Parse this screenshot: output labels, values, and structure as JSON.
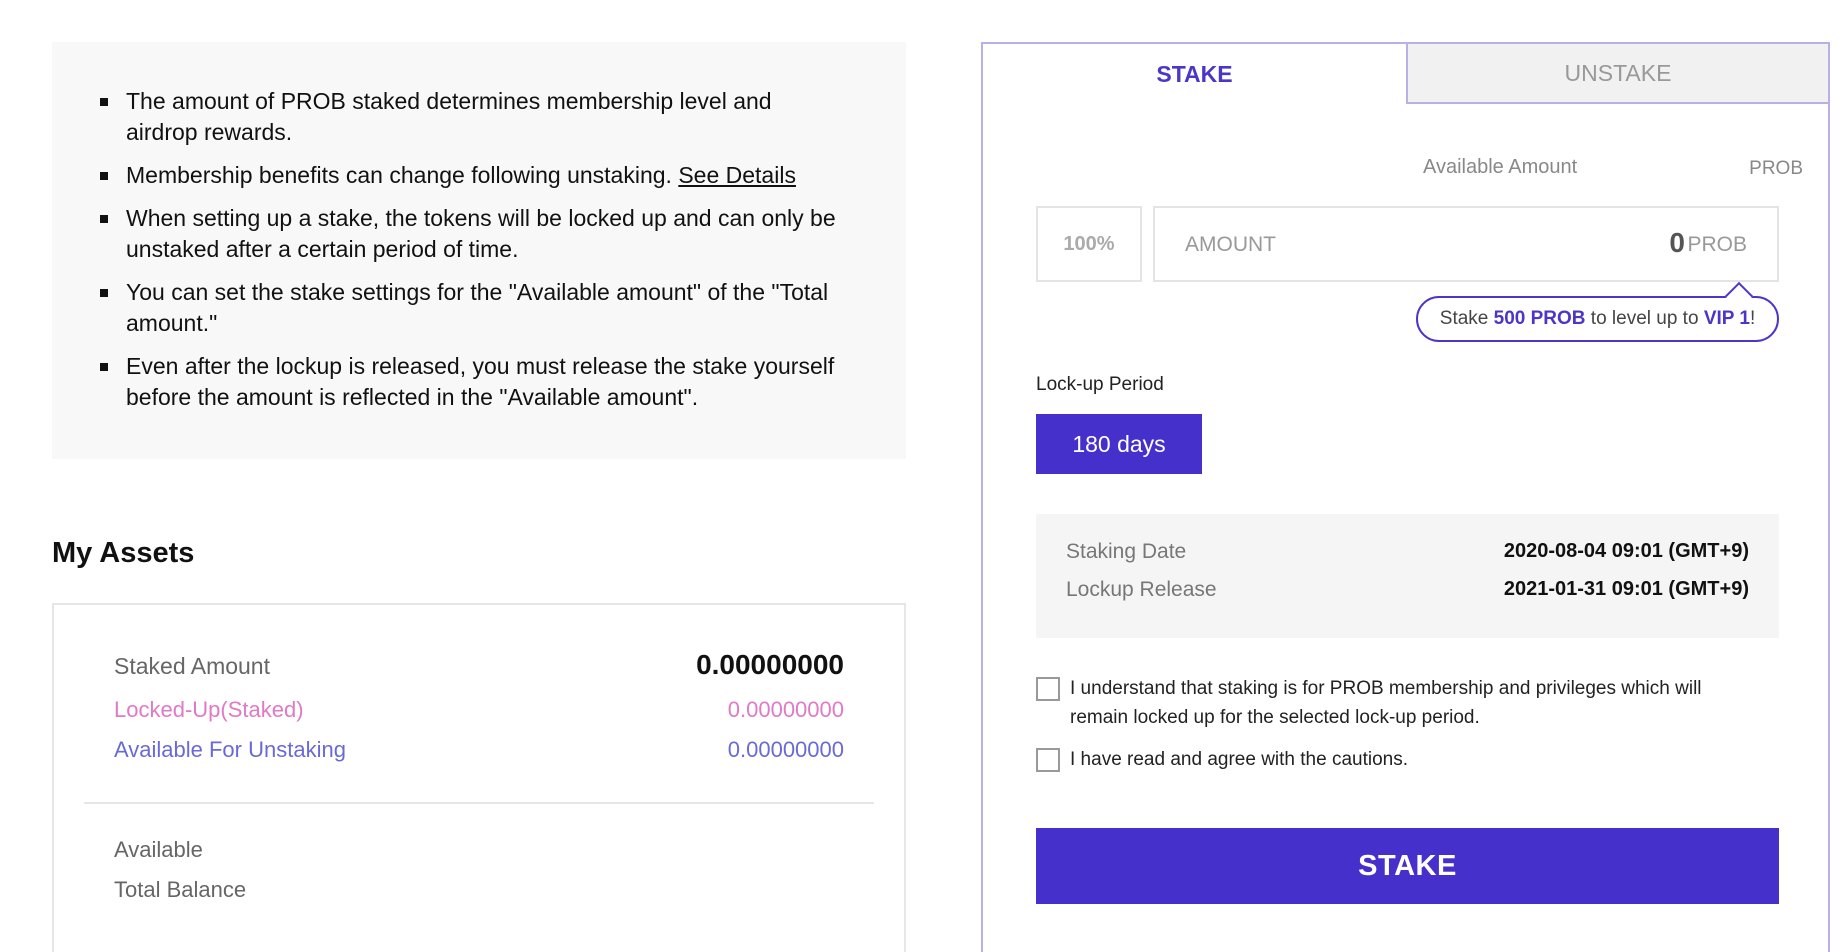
{
  "notice": {
    "items": [
      "The amount of PROB staked determines membership level and airdrop rewards.",
      "Membership benefits can change following unstaking.",
      "When setting up a stake, the tokens will be locked up and can only be unstaked after a certain period of time.",
      "You can set the stake settings for the \"Available amount\" of the \"Total amount.\"",
      "Even after the lockup is released, you must release the stake yourself before the amount is reflected in the \"Available amount\"."
    ],
    "see_details": "See Details"
  },
  "assets": {
    "title": "My Assets",
    "staked_label": "Staked Amount",
    "staked_value": "0.00000000",
    "locked_label": "Locked-Up(Staked)",
    "locked_value": "0.00000000",
    "unstaking_label": "Available For Unstaking",
    "unstaking_value": "0.00000000",
    "available_label": "Available",
    "total_label": "Total Balance"
  },
  "panel": {
    "tabs": {
      "stake": "STAKE",
      "unstake": "UNSTAKE"
    },
    "available_label": "Available Amount",
    "available_unit": "PROB",
    "percent_button": "100%",
    "amount_placeholder": "AMOUNT",
    "amount_value": "0",
    "amount_unit": "PROB",
    "tooltip": {
      "prefix": "Stake ",
      "amount": "500 PROB",
      "middle": " to level up to ",
      "level": "VIP 1",
      "suffix": "!"
    },
    "lock_label": "Lock-up Period",
    "lock_value": "180 days",
    "staking_date_label": "Staking Date",
    "staking_date_value": "2020-08-04 09:01 (GMT+9)",
    "release_label": "Lockup Release",
    "release_value": "2021-01-31 09:01 (GMT+9)",
    "checkbox1": "I understand that staking is for PROB membership and privileges which will remain locked up for the selected lock-up period.",
    "checkbox2": "I have read and agree with the cautions.",
    "submit": "STAKE"
  },
  "colors": {
    "accent": "#4530cc",
    "locked": "#e07ac6",
    "unstaking": "#6a6ad6"
  }
}
